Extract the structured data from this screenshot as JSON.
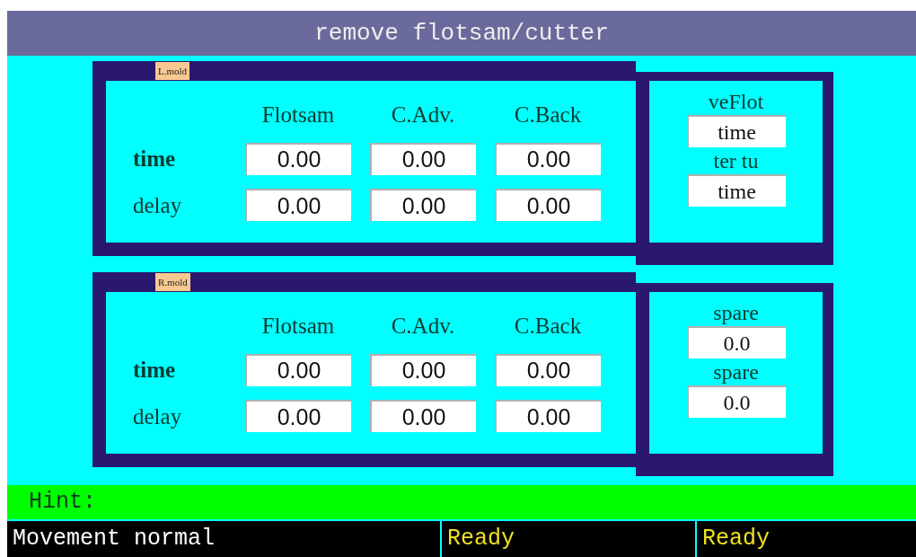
{
  "title": "remove flotsam/cutter",
  "groups": [
    {
      "label": "L.mold",
      "columns": [
        "Flotsam",
        "C.Adv.",
        "C.Back"
      ],
      "rows": [
        {
          "label": "time",
          "values": [
            "0.00",
            "0.00",
            "0.00"
          ]
        },
        {
          "label": "delay",
          "values": [
            "0.00",
            "0.00",
            "0.00"
          ]
        }
      ],
      "side": [
        {
          "label": "veFlot",
          "value": "time"
        },
        {
          "label": "ter tu",
          "value": "time"
        }
      ]
    },
    {
      "label": "R.mold",
      "columns": [
        "Flotsam",
        "C.Adv.",
        "C.Back"
      ],
      "rows": [
        {
          "label": "time",
          "values": [
            "0.00",
            "0.00",
            "0.00"
          ]
        },
        {
          "label": "delay",
          "values": [
            "0.00",
            "0.00",
            "0.00"
          ]
        }
      ],
      "side": [
        {
          "label": "spare",
          "value": "0.0"
        },
        {
          "label": "spare",
          "value": "0.0"
        }
      ]
    }
  ],
  "hint": {
    "label": "Hint:"
  },
  "status_bar": [
    {
      "text": "Movement normal",
      "kind": "message"
    },
    {
      "text": "Ready",
      "kind": "state"
    },
    {
      "text": "Ready",
      "kind": "state"
    }
  ]
}
